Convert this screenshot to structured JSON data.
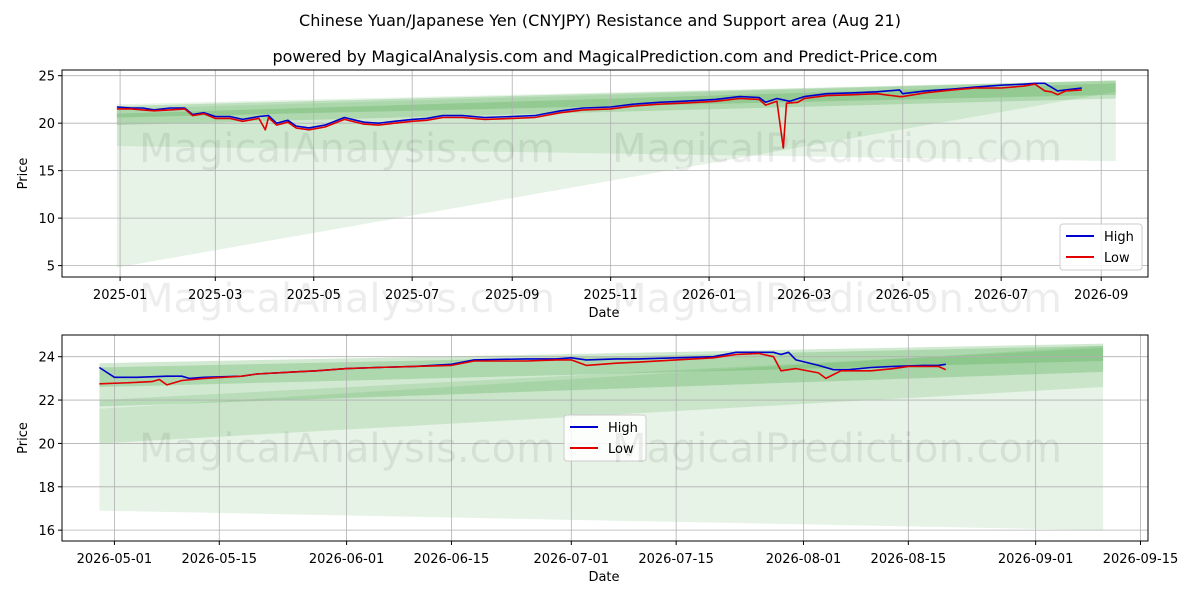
{
  "title": "Chinese Yuan/Japanese Yen (CNYJPY) Resistance and Support area (Aug 21)",
  "subtitle": "powered by MagicalAnalysis.com and MagicalPrediction.com and Predict-Price.com",
  "watermarks": [
    "MagicalAnalysis.com",
    "MagicalPrediction.com"
  ],
  "colors": {
    "high": "#0000cc",
    "low": "#e00000",
    "band": "#2e9a2e",
    "grid": "#b0b0b0"
  },
  "chart_data": [
    {
      "type": "line",
      "xlabel": "Date",
      "ylabel": "Price",
      "xlim": [
        "2024-11-26",
        "2026-09-30"
      ],
      "ylim": [
        3.8,
        25.6
      ],
      "yticks": [
        5,
        10,
        15,
        20,
        25
      ],
      "xticks": [
        "2025-01",
        "2025-03",
        "2025-05",
        "2025-07",
        "2025-09",
        "2025-11",
        "2026-01",
        "2026-03",
        "2026-05",
        "2026-07",
        "2026-09"
      ],
      "grid": true,
      "legend_position": "lower-right",
      "series": [
        {
          "name": "High",
          "color": "#0000cc",
          "points": [
            [
              "2024-12-30",
              21.7
            ],
            [
              "2025-01-08",
              21.6
            ],
            [
              "2025-01-15",
              21.6
            ],
            [
              "2025-01-22",
              21.4
            ],
            [
              "2025-02-01",
              21.6
            ],
            [
              "2025-02-10",
              21.6
            ],
            [
              "2025-02-15",
              20.9
            ],
            [
              "2025-02-22",
              21.1
            ],
            [
              "2025-03-01",
              20.7
            ],
            [
              "2025-03-10",
              20.7
            ],
            [
              "2025-03-18",
              20.4
            ],
            [
              "2025-03-28",
              20.7
            ],
            [
              "2025-04-03",
              20.8
            ],
            [
              "2025-04-08",
              20.0
            ],
            [
              "2025-04-15",
              20.3
            ],
            [
              "2025-04-20",
              19.7
            ],
            [
              "2025-04-28",
              19.5
            ],
            [
              "2025-05-08",
              19.8
            ],
            [
              "2025-05-20",
              20.6
            ],
            [
              "2025-06-01",
              20.1
            ],
            [
              "2025-06-10",
              20.0
            ],
            [
              "2025-06-20",
              20.2
            ],
            [
              "2025-07-01",
              20.4
            ],
            [
              "2025-07-10",
              20.5
            ],
            [
              "2025-07-20",
              20.8
            ],
            [
              "2025-08-01",
              20.8
            ],
            [
              "2025-08-15",
              20.6
            ],
            [
              "2025-09-01",
              20.7
            ],
            [
              "2025-09-15",
              20.8
            ],
            [
              "2025-10-01",
              21.3
            ],
            [
              "2025-10-15",
              21.6
            ],
            [
              "2025-11-01",
              21.7
            ],
            [
              "2025-11-15",
              22.0
            ],
            [
              "2025-12-01",
              22.2
            ],
            [
              "2025-12-15",
              22.3
            ],
            [
              "2026-01-05",
              22.5
            ],
            [
              "2026-01-20",
              22.8
            ],
            [
              "2026-02-01",
              22.7
            ],
            [
              "2026-02-05",
              22.2
            ],
            [
              "2026-02-12",
              22.6
            ],
            [
              "2026-02-20",
              22.3
            ],
            [
              "2026-03-01",
              22.8
            ],
            [
              "2026-03-15",
              23.1
            ],
            [
              "2026-04-01",
              23.2
            ],
            [
              "2026-04-15",
              23.3
            ],
            [
              "2026-04-29",
              23.5
            ],
            [
              "2026-05-01",
              23.1
            ],
            [
              "2026-05-15",
              23.4
            ],
            [
              "2026-06-01",
              23.6
            ],
            [
              "2026-06-15",
              23.8
            ],
            [
              "2026-07-01",
              24.0
            ],
            [
              "2026-07-15",
              24.1
            ],
            [
              "2026-07-22",
              24.2
            ],
            [
              "2026-07-28",
              24.2
            ],
            [
              "2026-08-01",
              23.8
            ],
            [
              "2026-08-05",
              23.4
            ],
            [
              "2026-08-10",
              23.5
            ],
            [
              "2026-08-20",
              23.7
            ]
          ]
        },
        {
          "name": "Low",
          "color": "#e00000",
          "points": [
            [
              "2024-12-30",
              21.5
            ],
            [
              "2025-01-08",
              21.5
            ],
            [
              "2025-01-15",
              21.4
            ],
            [
              "2025-01-22",
              21.3
            ],
            [
              "2025-02-01",
              21.4
            ],
            [
              "2025-02-10",
              21.5
            ],
            [
              "2025-02-15",
              20.8
            ],
            [
              "2025-02-22",
              21.0
            ],
            [
              "2025-03-01",
              20.5
            ],
            [
              "2025-03-10",
              20.5
            ],
            [
              "2025-03-18",
              20.2
            ],
            [
              "2025-03-28",
              20.5
            ],
            [
              "2025-04-01",
              19.3
            ],
            [
              "2025-04-03",
              20.6
            ],
            [
              "2025-04-08",
              19.8
            ],
            [
              "2025-04-15",
              20.1
            ],
            [
              "2025-04-20",
              19.5
            ],
            [
              "2025-04-28",
              19.3
            ],
            [
              "2025-05-08",
              19.6
            ],
            [
              "2025-05-20",
              20.4
            ],
            [
              "2025-06-01",
              19.9
            ],
            [
              "2025-06-10",
              19.8
            ],
            [
              "2025-06-20",
              20.0
            ],
            [
              "2025-07-01",
              20.2
            ],
            [
              "2025-07-10",
              20.3
            ],
            [
              "2025-07-20",
              20.6
            ],
            [
              "2025-08-01",
              20.6
            ],
            [
              "2025-08-15",
              20.4
            ],
            [
              "2025-09-01",
              20.5
            ],
            [
              "2025-09-15",
              20.6
            ],
            [
              "2025-10-01",
              21.1
            ],
            [
              "2025-10-15",
              21.4
            ],
            [
              "2025-11-01",
              21.5
            ],
            [
              "2025-11-15",
              21.8
            ],
            [
              "2025-12-01",
              22.0
            ],
            [
              "2025-12-15",
              22.1
            ],
            [
              "2026-01-05",
              22.3
            ],
            [
              "2026-01-20",
              22.6
            ],
            [
              "2026-02-01",
              22.5
            ],
            [
              "2026-02-05",
              21.9
            ],
            [
              "2026-02-12",
              22.3
            ],
            [
              "2026-02-16",
              17.4
            ],
            [
              "2026-02-18",
              22.1
            ],
            [
              "2026-02-25",
              22.2
            ],
            [
              "2026-03-01",
              22.6
            ],
            [
              "2026-03-15",
              22.9
            ],
            [
              "2026-04-01",
              23.0
            ],
            [
              "2026-04-15",
              23.1
            ],
            [
              "2026-04-29",
              22.8
            ],
            [
              "2026-05-01",
              22.8
            ],
            [
              "2026-05-15",
              23.2
            ],
            [
              "2026-06-01",
              23.5
            ],
            [
              "2026-06-15",
              23.7
            ],
            [
              "2026-07-01",
              23.7
            ],
            [
              "2026-07-15",
              23.9
            ],
            [
              "2026-07-22",
              24.1
            ],
            [
              "2026-07-28",
              23.4
            ],
            [
              "2026-08-01",
              23.3
            ],
            [
              "2026-08-05",
              23.0
            ],
            [
              "2026-08-10",
              23.4
            ],
            [
              "2026-08-20",
              23.5
            ]
          ]
        }
      ],
      "bands": [
        {
          "x0": "2024-12-30",
          "x1": "2026-09-10",
          "y0_lo": 4.8,
          "y0_hi": 21.5,
          "y1_lo": 23.3,
          "y1_hi": 24.5,
          "opacity": 0.12
        },
        {
          "x0": "2024-12-30",
          "x1": "2026-09-10",
          "y0_lo": 17.6,
          "y0_hi": 22.0,
          "y1_lo": 16.0,
          "y1_hi": 24.5,
          "opacity": 0.12
        },
        {
          "x0": "2024-12-30",
          "x1": "2026-09-10",
          "y0_lo": 19.8,
          "y0_hi": 21.0,
          "y1_lo": 22.6,
          "y1_hi": 24.2,
          "opacity": 0.2
        },
        {
          "x0": "2024-12-30",
          "x1": "2026-09-10",
          "y0_lo": 20.6,
          "y0_hi": 21.8,
          "y1_lo": 23.0,
          "y1_hi": 24.5,
          "opacity": 0.22
        }
      ]
    },
    {
      "type": "line",
      "xlabel": "Date",
      "ylabel": "Price",
      "xlim": [
        "2026-04-24",
        "2026-09-16"
      ],
      "ylim": [
        15.5,
        25.0
      ],
      "yticks": [
        16,
        18,
        20,
        22,
        24
      ],
      "xticks": [
        "2026-05-01",
        "2026-05-15",
        "2026-06-01",
        "2026-06-15",
        "2026-07-01",
        "2026-07-15",
        "2026-08-01",
        "2026-08-15",
        "2026-09-01",
        "2026-09-15"
      ],
      "grid": true,
      "legend_position": "center",
      "series": [
        {
          "name": "High",
          "color": "#0000cc",
          "points": [
            [
              "2026-04-29",
              23.5
            ],
            [
              "2026-05-01",
              23.05
            ],
            [
              "2026-05-04",
              23.05
            ],
            [
              "2026-05-08",
              23.1
            ],
            [
              "2026-05-10",
              23.1
            ],
            [
              "2026-05-11",
              23.0
            ],
            [
              "2026-05-13",
              23.05
            ],
            [
              "2026-05-18",
              23.1
            ],
            [
              "2026-05-20",
              23.2
            ],
            [
              "2026-05-25",
              23.3
            ],
            [
              "2026-05-28",
              23.35
            ],
            [
              "2026-06-01",
              23.45
            ],
            [
              "2026-06-05",
              23.5
            ],
            [
              "2026-06-10",
              23.55
            ],
            [
              "2026-06-15",
              23.65
            ],
            [
              "2026-06-18",
              23.85
            ],
            [
              "2026-06-25",
              23.9
            ],
            [
              "2026-06-29",
              23.9
            ],
            [
              "2026-07-01",
              23.95
            ],
            [
              "2026-07-03",
              23.85
            ],
            [
              "2026-07-07",
              23.9
            ],
            [
              "2026-07-10",
              23.9
            ],
            [
              "2026-07-15",
              23.95
            ],
            [
              "2026-07-20",
              24.0
            ],
            [
              "2026-07-23",
              24.2
            ],
            [
              "2026-07-28",
              24.2
            ],
            [
              "2026-07-29",
              24.1
            ],
            [
              "2026-07-30",
              24.2
            ],
            [
              "2026-07-31",
              23.85
            ],
            [
              "2026-08-03",
              23.6
            ],
            [
              "2026-08-05",
              23.4
            ],
            [
              "2026-08-07",
              23.4
            ],
            [
              "2026-08-10",
              23.5
            ],
            [
              "2026-08-13",
              23.55
            ],
            [
              "2026-08-17",
              23.6
            ],
            [
              "2026-08-19",
              23.6
            ],
            [
              "2026-08-20",
              23.65
            ]
          ]
        },
        {
          "name": "Low",
          "color": "#e00000",
          "points": [
            [
              "2026-04-29",
              22.75
            ],
            [
              "2026-05-03",
              22.8
            ],
            [
              "2026-05-06",
              22.85
            ],
            [
              "2026-05-07",
              22.95
            ],
            [
              "2026-05-08",
              22.7
            ],
            [
              "2026-05-10",
              22.9
            ],
            [
              "2026-05-13",
              23.0
            ],
            [
              "2026-05-18",
              23.1
            ],
            [
              "2026-05-20",
              23.2
            ],
            [
              "2026-05-25",
              23.3
            ],
            [
              "2026-05-28",
              23.35
            ],
            [
              "2026-06-01",
              23.45
            ],
            [
              "2026-06-05",
              23.5
            ],
            [
              "2026-06-10",
              23.55
            ],
            [
              "2026-06-15",
              23.6
            ],
            [
              "2026-06-18",
              23.8
            ],
            [
              "2026-06-25",
              23.8
            ],
            [
              "2026-06-29",
              23.85
            ],
            [
              "2026-07-01",
              23.85
            ],
            [
              "2026-07-03",
              23.6
            ],
            [
              "2026-07-07",
              23.7
            ],
            [
              "2026-07-10",
              23.75
            ],
            [
              "2026-07-15",
              23.85
            ],
            [
              "2026-07-20",
              23.95
            ],
            [
              "2026-07-23",
              24.1
            ],
            [
              "2026-07-26",
              24.15
            ],
            [
              "2026-07-28",
              24.0
            ],
            [
              "2026-07-29",
              23.35
            ],
            [
              "2026-07-31",
              23.45
            ],
            [
              "2026-08-03",
              23.25
            ],
            [
              "2026-08-04",
              23.0
            ],
            [
              "2026-08-06",
              23.35
            ],
            [
              "2026-08-10",
              23.35
            ],
            [
              "2026-08-13",
              23.45
            ],
            [
              "2026-08-15",
              23.55
            ],
            [
              "2026-08-19",
              23.55
            ],
            [
              "2026-08-20",
              23.4
            ]
          ]
        }
      ],
      "bands": [
        {
          "x0": "2026-04-29",
          "x1": "2026-09-10",
          "y0_lo": 16.9,
          "y0_hi": 21.6,
          "y1_lo": 16.0,
          "y1_hi": 24.5,
          "opacity": 0.12
        },
        {
          "x0": "2026-04-29",
          "x1": "2026-09-10",
          "y0_lo": 20.0,
          "y0_hi": 22.0,
          "y1_lo": 22.6,
          "y1_hi": 24.4,
          "opacity": 0.15
        },
        {
          "x0": "2026-04-29",
          "x1": "2026-09-10",
          "y0_lo": 21.7,
          "y0_hi": 23.5,
          "y1_lo": 23.3,
          "y1_hi": 24.5,
          "opacity": 0.22
        },
        {
          "x0": "2026-04-29",
          "x1": "2026-09-10",
          "y0_lo": 22.6,
          "y0_hi": 23.7,
          "y1_lo": 23.8,
          "y1_hi": 24.6,
          "opacity": 0.22
        }
      ]
    }
  ]
}
